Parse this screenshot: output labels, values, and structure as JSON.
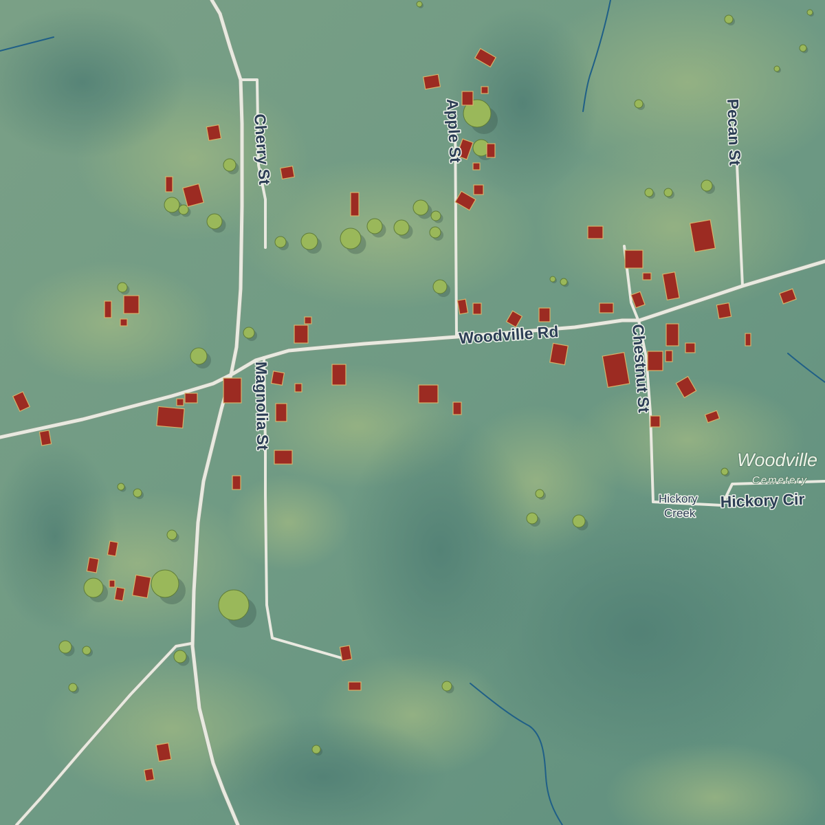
{
  "map": {
    "roads": {
      "woodville_rd": "Woodville Rd",
      "cherry_st": "Cherry St",
      "apple_st": "Apple St",
      "pecan_st": "Pecan St",
      "magnolia_st": "Magnolia St",
      "chestnut_st": "Chestnut St",
      "hickory_cir": "Hickory Cir"
    },
    "water": {
      "hickory_creek_line1": "Hickory",
      "hickory_creek_line2": "Creek"
    },
    "places": {
      "cemetery_name": "Woodville",
      "cemetery_type": "Cemetery"
    },
    "colors": {
      "grass": "#6f9a83",
      "road": "#e9e9e0",
      "building": "#9c2b22",
      "creek": "#1f5f87",
      "label": "#2c3e55"
    },
    "icons": [
      "building-icon",
      "tree-icon",
      "creek-line"
    ]
  }
}
